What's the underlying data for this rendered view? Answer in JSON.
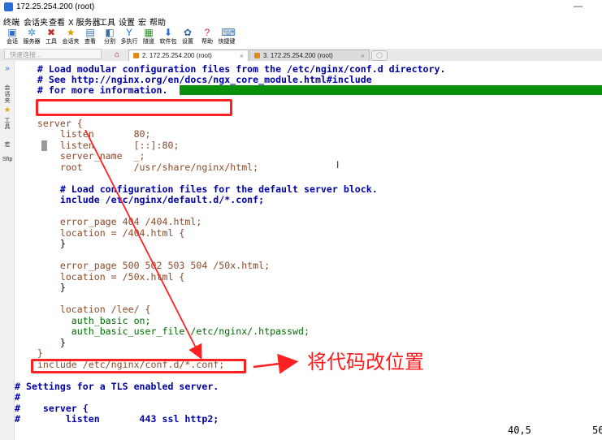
{
  "window": {
    "title": "172.25.254.200 (root)",
    "minimize": "—"
  },
  "menu": [
    "终端",
    "会话夹",
    "查看",
    "X 服务器",
    "工具",
    "设置",
    "宏",
    "帮助"
  ],
  "toolbar": [
    {
      "label": "会话",
      "icon": "session-icon"
    },
    {
      "label": "服务器",
      "icon": "servers-icon"
    },
    {
      "label": "工具",
      "icon": "tools-icon"
    },
    {
      "label": "会话夹",
      "icon": "star-icon"
    },
    {
      "label": "查看",
      "icon": "view-icon"
    },
    {
      "label": "分割",
      "icon": "split-icon"
    },
    {
      "label": "多执行",
      "icon": "multiexec-icon"
    },
    {
      "label": "隧道",
      "icon": "tunnel-icon"
    },
    {
      "label": "软件包",
      "icon": "packages-icon"
    },
    {
      "label": "设置",
      "icon": "settings-icon"
    },
    {
      "label": "帮助",
      "icon": "help-icon"
    },
    {
      "label": "快捷键",
      "icon": "shortcut-icon"
    }
  ],
  "xserver_label": "X 服",
  "quick_connect_placeholder": "快速连接...",
  "tabs": [
    {
      "label": "2. 172.25.254.200 (root)",
      "active": true
    },
    {
      "label": "3. 172.25.254.200 (root)",
      "active": false
    }
  ],
  "sidebar": [
    "会话夹",
    "工具",
    "宏",
    "Sftp"
  ],
  "terminal": {
    "lines": [
      "    # Load modular configuration files from the /etc/nginx/conf.d directory.",
      "    # See http://nginx.org/en/docs/ngx_core_module.html#include",
      "    # for more information.",
      "",
      "",
      "    server {",
      "        listen       80;",
      "        listen       [::]:80;",
      "        server_name  _;",
      "        root         /usr/share/nginx/html;",
      "",
      "        # Load configuration files for the default server block.",
      "        include /etc/nginx/default.d/*.conf;",
      "",
      "        error_page 404 /404.html;",
      "        location = /404.html {",
      "        }",
      "",
      "        error_page 500 502 503 504 /50x.html;",
      "        location = /50x.html {",
      "        }",
      "",
      "        location /lee/ {",
      "          auth_basic on;",
      "          auth_basic_user_file /etc/nginx/.htpasswd;",
      "        }",
      "    }",
      "    include /etc/nginx/conf.d/*.conf;",
      "",
      "# Settings for a TLS enabled server.",
      "#",
      "#    server {",
      "#        listen       443 ssl http2;"
    ],
    "status_position": "40,5",
    "status_percent": "56"
  },
  "annotation": {
    "text": "将代码改位置",
    "color": "#ff1a1a"
  },
  "colors": {
    "comment": "#0000a8",
    "keyword": "#8b4a2a",
    "directive": "#006c00",
    "highlight": "#0a8f0a",
    "annotation": "#ff2121"
  }
}
